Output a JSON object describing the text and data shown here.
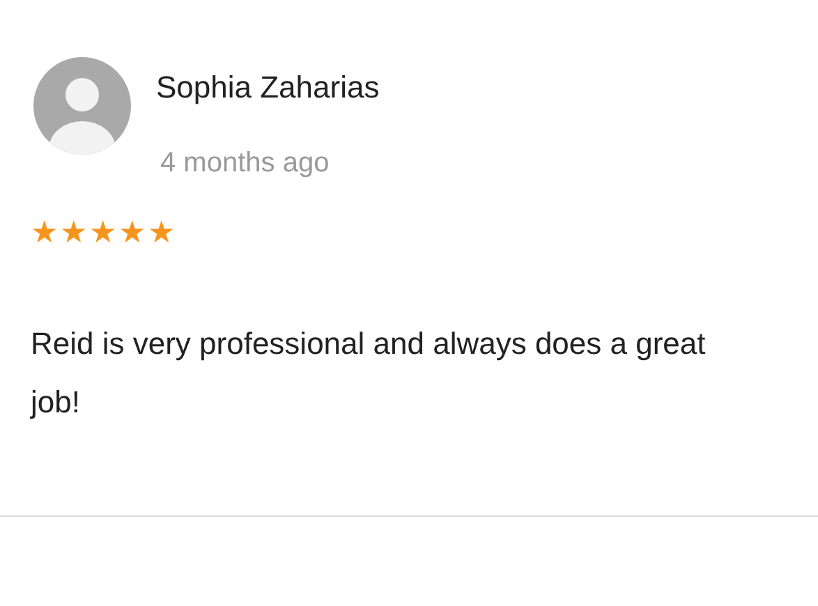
{
  "review": {
    "author": "Sophia Zaharias",
    "time": "4 months ago",
    "stars": 5,
    "text": "Reid is very professional and always does a great job!"
  }
}
